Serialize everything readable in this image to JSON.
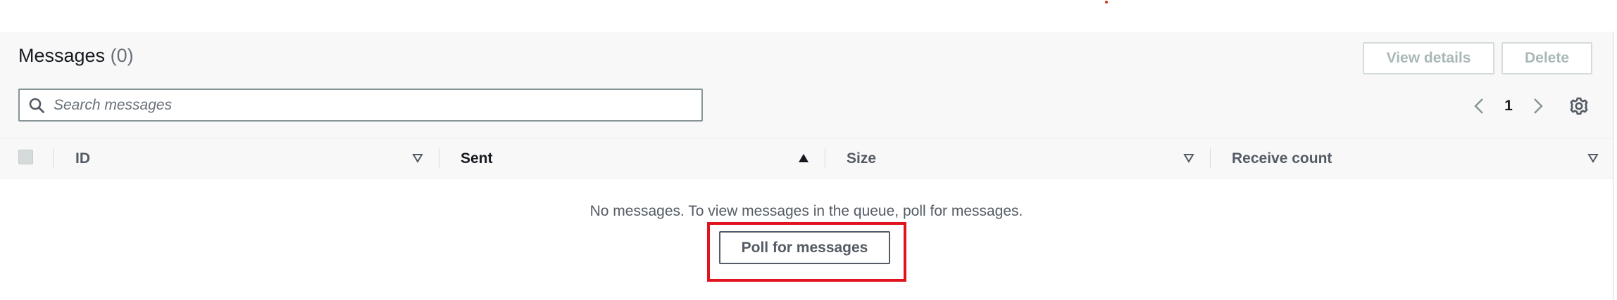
{
  "messages_panel": {
    "title": "Messages",
    "count": "(0)",
    "view_details_label": "View details",
    "delete_label": "Delete",
    "search": {
      "placeholder": "Search messages",
      "icon": "search-icon"
    },
    "pagination": {
      "current_page": "1",
      "prev_icon": "chevron-left-icon",
      "next_icon": "chevron-right-icon"
    },
    "settings_icon": "gear-icon",
    "table": {
      "columns": [
        {
          "label": "ID",
          "sort": "sortable-down"
        },
        {
          "label": "Sent",
          "sort": "sorted-ascending"
        },
        {
          "label": "Size",
          "sort": "sortable-down"
        },
        {
          "label": "Receive count",
          "sort": "sortable-down"
        }
      ],
      "empty_message": "No messages. To view messages in the queue, poll for messages.",
      "poll_button_label": "Poll for messages"
    }
  },
  "colors": {
    "header_bg": "#f8f8f8",
    "highlight": "#e0141e",
    "text_primary": "#16191f",
    "text_secondary": "#545b64",
    "disabled": "#aab7b8"
  }
}
